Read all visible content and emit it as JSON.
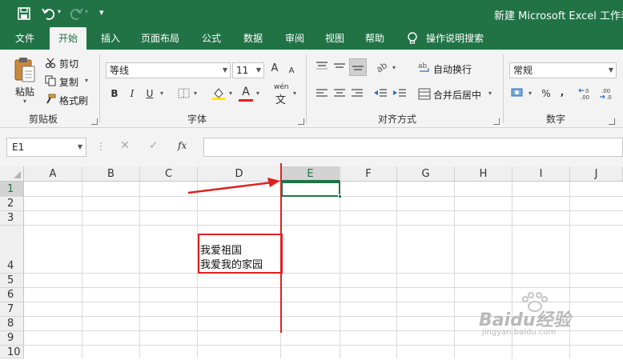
{
  "title_bar": {
    "window_title": "新建 Microsoft Excel 工作表",
    "qat_more": "▾"
  },
  "tabs": [
    {
      "label": "文件",
      "active": false
    },
    {
      "label": "开始",
      "active": true
    },
    {
      "label": "插入",
      "active": false
    },
    {
      "label": "页面布局",
      "active": false
    },
    {
      "label": "公式",
      "active": false
    },
    {
      "label": "数据",
      "active": false
    },
    {
      "label": "审阅",
      "active": false
    },
    {
      "label": "视图",
      "active": false
    },
    {
      "label": "帮助",
      "active": false
    }
  ],
  "tell_me": "操作说明搜索",
  "clipboard": {
    "group_label": "剪贴板",
    "paste": "粘贴",
    "cut": "剪切",
    "copy": "复制",
    "format_painter": "格式刷"
  },
  "font": {
    "group_label": "字体",
    "font_name": "等线",
    "font_size": "11",
    "bold": "B",
    "italic": "I",
    "underline": "U",
    "wen": "wén",
    "wen_char": "文",
    "font_color_glyph": "A",
    "grow": "A",
    "shrink": "A"
  },
  "alignment": {
    "group_label": "对齐方式",
    "wrap_text": "自动换行",
    "merge_center": "合并后居中"
  },
  "number": {
    "group_label": "数字",
    "format": "常规",
    "percent": "%",
    "comma": ","
  },
  "formula_bar": {
    "name_box": "E1",
    "fx": "fx",
    "formula_value": ""
  },
  "sheet": {
    "columns": [
      "A",
      "B",
      "C",
      "D",
      "E",
      "F",
      "G",
      "H",
      "I",
      "J"
    ],
    "selected_column": "E",
    "rows": [
      "1",
      "2",
      "3",
      "4",
      "5",
      "6",
      "7",
      "8",
      "9",
      "10"
    ],
    "selected_row": "1",
    "d4_line1": "我爱祖国",
    "d4_line2": "我爱我的家园"
  },
  "watermark": {
    "brand": "Baidu经验",
    "url": "jingyan.baidu.com"
  },
  "colors": {
    "excel_green": "#217346",
    "annotation_red": "#e02020"
  }
}
